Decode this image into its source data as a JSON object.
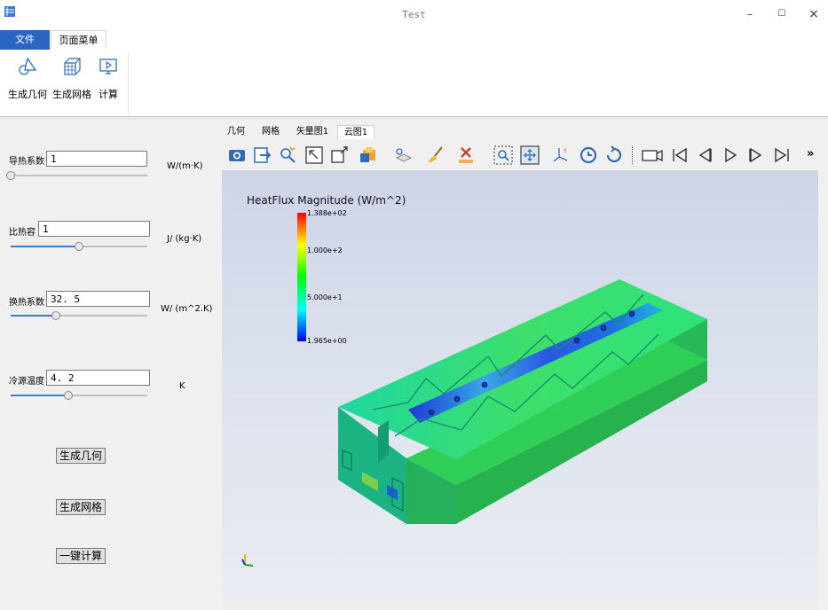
{
  "window": {
    "title": "Test",
    "minimize": "–",
    "maximize": "☐",
    "close": "×"
  },
  "ribbon": {
    "tabs": [
      "文件",
      "页面菜单"
    ],
    "buttons": [
      {
        "label": "生成几何",
        "icon": "geometry-icon"
      },
      {
        "label": "生成网格",
        "icon": "mesh-icon"
      },
      {
        "label": "计算",
        "icon": "compute-icon"
      }
    ]
  },
  "params": [
    {
      "label": "导热系数",
      "value": "1",
      "unit": "W/(m·K)",
      "slider_fraction": 0.0
    },
    {
      "label": "比热容",
      "value": "1",
      "unit": "J/ (kg·K)",
      "slider_fraction": 0.5
    },
    {
      "label": "换热系数",
      "value": "32. 5",
      "unit": "W/ (m^2.K)",
      "slider_fraction": 0.33
    },
    {
      "label": "冷源温度",
      "value": "4. 2",
      "unit": "K",
      "slider_fraction": 0.42
    }
  ],
  "actions": {
    "gen_geometry": "生成几何",
    "gen_mesh": "生成网格",
    "one_click": "一键计算"
  },
  "view_tabs": [
    "几何",
    "网格",
    "矢量图1",
    "云图1"
  ],
  "view_toolbar": {
    "icons": [
      "screenshot-icon",
      "export-icon",
      "pick-icon",
      "select-box-icon",
      "reset-view-icon",
      "color-icon",
      "visibility-icon",
      "paint-icon",
      "clear-icon",
      "zoom-box-icon",
      "fit-view-icon",
      "axes-icon",
      "rotate-ccw-icon",
      "rotate-cw-icon",
      "camera-icon",
      "first-frame-icon",
      "prev-frame-icon",
      "play-icon",
      "next-frame-icon",
      "last-frame-icon"
    ],
    "more": "»"
  },
  "legend": {
    "title": "HeatFlux Magnitude (W/m^2)",
    "ticks": [
      "1.388e+02",
      "1.000e+2",
      "5.000e+1",
      "1.965e+00"
    ],
    "colors": [
      "#ff0000",
      "#ffff00",
      "#00ff00",
      "#00ffff",
      "#0000ff"
    ]
  },
  "colors": {
    "accent": "#2b65c2",
    "slider": "#3b7bbf"
  }
}
